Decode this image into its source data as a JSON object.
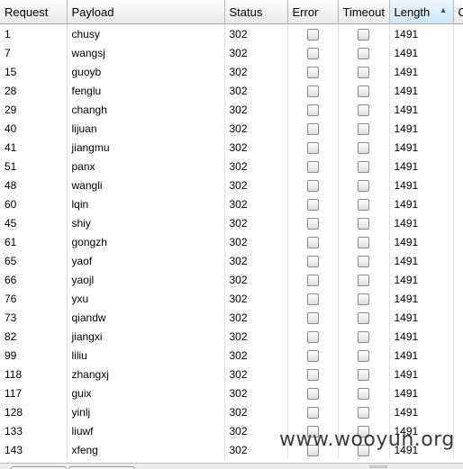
{
  "columns": [
    {
      "key": "request",
      "label": "Request"
    },
    {
      "key": "payload",
      "label": "Payload"
    },
    {
      "key": "status",
      "label": "Status"
    },
    {
      "key": "error",
      "label": "Error"
    },
    {
      "key": "timeout",
      "label": "Timeout"
    },
    {
      "key": "length",
      "label": "Length",
      "sort": "ascending"
    },
    {
      "key": "comment",
      "label": "C"
    }
  ],
  "rows": [
    {
      "request": "1",
      "payload": "chusy",
      "status": "302",
      "error": false,
      "timeout": false,
      "length": "1491"
    },
    {
      "request": "7",
      "payload": "wangsj",
      "status": "302",
      "error": false,
      "timeout": false,
      "length": "1491"
    },
    {
      "request": "15",
      "payload": "guoyb",
      "status": "302",
      "error": false,
      "timeout": false,
      "length": "1491"
    },
    {
      "request": "28",
      "payload": "fenglu",
      "status": "302",
      "error": false,
      "timeout": false,
      "length": "1491"
    },
    {
      "request": "29",
      "payload": "changh",
      "status": "302",
      "error": false,
      "timeout": false,
      "length": "1491"
    },
    {
      "request": "40",
      "payload": "lijuan",
      "status": "302",
      "error": false,
      "timeout": false,
      "length": "1491"
    },
    {
      "request": "41",
      "payload": "jiangmu",
      "status": "302",
      "error": false,
      "timeout": false,
      "length": "1491"
    },
    {
      "request": "51",
      "payload": "panx",
      "status": "302",
      "error": false,
      "timeout": false,
      "length": "1491"
    },
    {
      "request": "48",
      "payload": "wangli",
      "status": "302",
      "error": false,
      "timeout": false,
      "length": "1491"
    },
    {
      "request": "60",
      "payload": "lqin",
      "status": "302",
      "error": false,
      "timeout": false,
      "length": "1491"
    },
    {
      "request": "45",
      "payload": "shiy",
      "status": "302",
      "error": false,
      "timeout": false,
      "length": "1491"
    },
    {
      "request": "61",
      "payload": "gongzh",
      "status": "302",
      "error": false,
      "timeout": false,
      "length": "1491"
    },
    {
      "request": "65",
      "payload": "yaof",
      "status": "302",
      "error": false,
      "timeout": false,
      "length": "1491"
    },
    {
      "request": "66",
      "payload": "yaojl",
      "status": "302",
      "error": false,
      "timeout": false,
      "length": "1491"
    },
    {
      "request": "76",
      "payload": "yxu",
      "status": "302",
      "error": false,
      "timeout": false,
      "length": "1491"
    },
    {
      "request": "73",
      "payload": "qiandw",
      "status": "302",
      "error": false,
      "timeout": false,
      "length": "1491"
    },
    {
      "request": "82",
      "payload": "jiangxi",
      "status": "302",
      "error": false,
      "timeout": false,
      "length": "1491"
    },
    {
      "request": "99",
      "payload": "liliu",
      "status": "302",
      "error": false,
      "timeout": false,
      "length": "1491"
    },
    {
      "request": "118",
      "payload": "zhangxj",
      "status": "302",
      "error": false,
      "timeout": false,
      "length": "1491"
    },
    {
      "request": "117",
      "payload": "guix",
      "status": "302",
      "error": false,
      "timeout": false,
      "length": "1491"
    },
    {
      "request": "128",
      "payload": "yinlj",
      "status": "302",
      "error": false,
      "timeout": false,
      "length": "1491"
    },
    {
      "request": "133",
      "payload": "liuwf",
      "status": "302",
      "error": false,
      "timeout": false,
      "length": "1491"
    },
    {
      "request": "143",
      "payload": "xfeng",
      "status": "302",
      "error": false,
      "timeout": false,
      "length": "1491"
    }
  ],
  "watermark": "www.wooyun.org"
}
